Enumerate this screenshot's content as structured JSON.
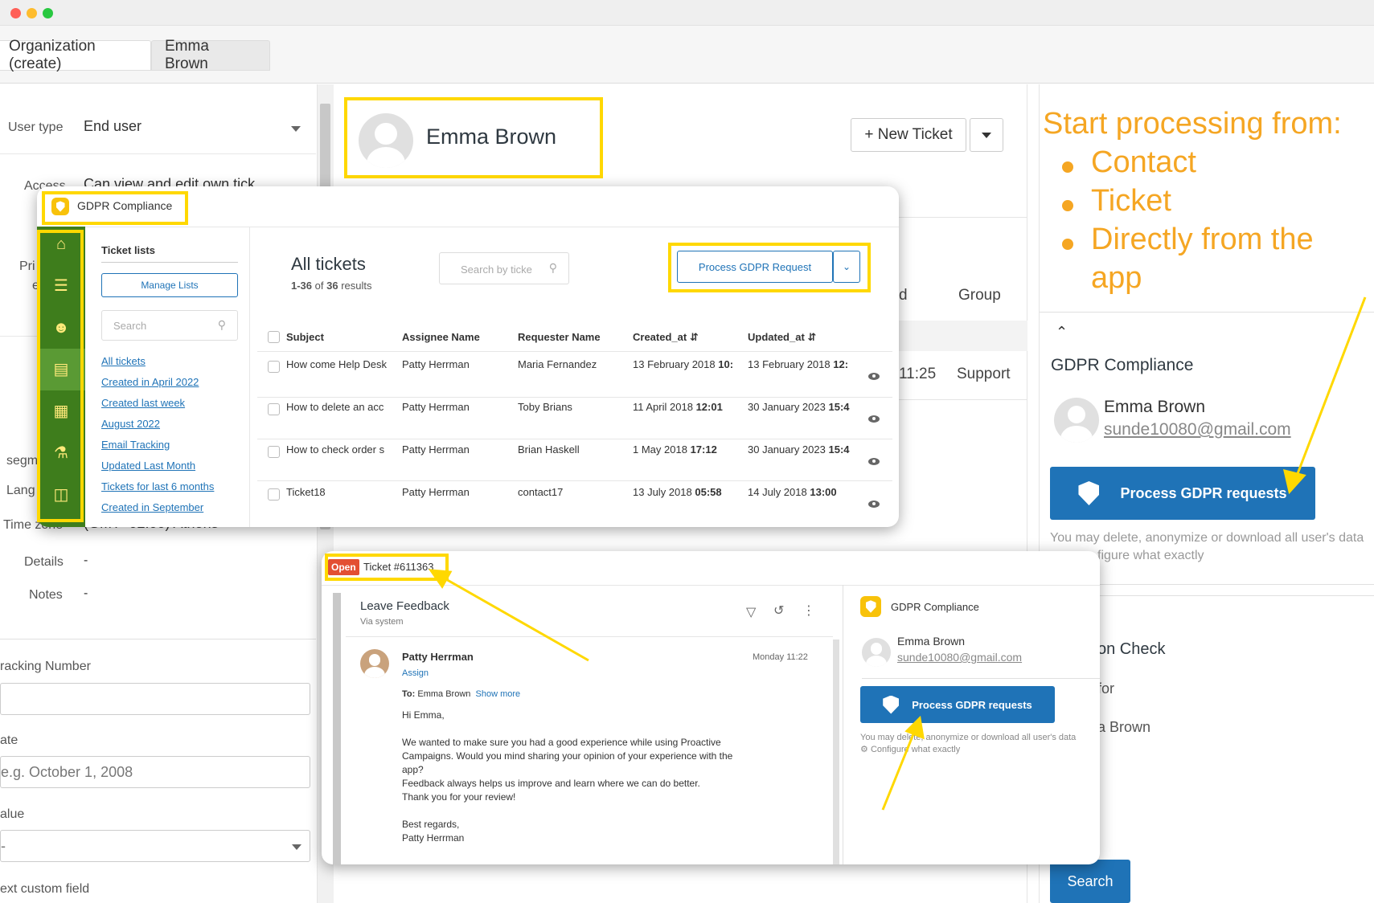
{
  "tabs": [
    "Organization (create)",
    "Emma Brown"
  ],
  "left_form": {
    "user_type_label": "User type",
    "user_type_value": "End user",
    "access_label": "Access",
    "access_value": "Can view and edit own tick",
    "primary_label": "Pri",
    "primary_label2": "e",
    "segment_label": "segm",
    "language_label": "Lang",
    "timezone_label": "Time zone",
    "timezone_value": "(GMT+02:00) Athens",
    "details_label": "Details",
    "details_value": "-",
    "notes_label": "Notes",
    "notes_value": "-",
    "tracking_label": "racking Number",
    "date_label": "ate",
    "date_placeholder": "e.g. October 1, 2008",
    "value_label": "alue",
    "value_value": "-",
    "custom_label": "ext custom field"
  },
  "mid": {
    "user_name": "Emma Brown",
    "new_ticket_label": "+ New Ticket",
    "col_d": "d",
    "col_group": "Group",
    "row_time": "11:25",
    "row_group": "Support"
  },
  "right": {
    "heading": "Start processing from:",
    "bullets": [
      "Contact",
      "Ticket",
      "Directly from the",
      "app"
    ],
    "panel_title": "GDPR Compliance",
    "user_name": "Emma Brown",
    "user_email": "sunde10080@gmail.com",
    "process_btn": "Process GDPR requests",
    "note1": "You may delete, anonymize or download all user's data",
    "note2": "figure what exactly",
    "section2": "on Check",
    "section2_for": "for",
    "section2_name": "a Brown",
    "search_btn": "Search"
  },
  "popup1": {
    "title": "GDPR Compliance",
    "ticket_lists": "Ticket lists",
    "manage_lists": "Manage Lists",
    "search_placeholder": "Search",
    "lists": [
      "All tickets",
      "Created in April 2022",
      "Created last week",
      "August 2022",
      "Email Tracking",
      "Updated Last Month",
      "Tickets for last 6 months",
      "Created in September"
    ],
    "all_tickets": "All tickets",
    "results_range": "1-36",
    "results_of": " of ",
    "results_total": "36",
    "results_word": " results",
    "search_tickets_placeholder": "Search by ticke",
    "process_btn": "Process GDPR Request",
    "columns": [
      "Subject",
      "Assignee Name",
      "Requester Name",
      "Created_at",
      "Updated_at"
    ],
    "rows": [
      {
        "subject": "How come Help Desk",
        "assignee": "Patty Herrman",
        "requester": "Maria Fernandez",
        "created_date": "13 February 2018",
        "created_time": "10:",
        "updated_date": "13 February 2018",
        "updated_time": "12:"
      },
      {
        "subject": "How to delete an acc",
        "assignee": "Patty Herrman",
        "requester": "Toby Brians",
        "created_date": "11 April 2018",
        "created_time": "12:01",
        "updated_date": "30 January 2023",
        "updated_time": "15:4"
      },
      {
        "subject": "How to check order s",
        "assignee": "Patty Herrman",
        "requester": "Brian Haskell",
        "created_date": "1 May 2018",
        "created_time": "17:12",
        "updated_date": "30 January 2023",
        "updated_time": "15:4"
      },
      {
        "subject": "Ticket18",
        "assignee": "Patty Herrman",
        "requester": "contact17",
        "created_date": "13 July 2018",
        "created_time": "05:58",
        "updated_date": "14 July 2018",
        "updated_time": "13:00"
      }
    ]
  },
  "popup2": {
    "status": "Open",
    "ticket_id": "Ticket #611363",
    "subject": "Leave Feedback",
    "via": "Via system",
    "author": "Patty Herrman",
    "assign": "Assign",
    "date": "Monday 11:22",
    "to_label": "To:",
    "to_value": "Emma Brown",
    "show_more": "Show more",
    "body": [
      "Hi Emma,",
      "",
      "We wanted to make sure you had a good experience while using Proactive",
      "Campaigns. Would you mind sharing your opinion of your experience with the",
      "app?",
      "Feedback always helps us improve and learn where we can do better.",
      "Thank you for your review!",
      "",
      "Best regards,",
      "Patty Herrman"
    ],
    "panel_title": "GDPR Compliance",
    "user_name": "Emma Brown",
    "user_email": "sunde10080@gmail.com",
    "process_btn": "Process GDPR requests",
    "note1": "You may delete, anonymize or download all user's data",
    "note2": "Configure what exactly"
  },
  "colors": {
    "highlight": "#ffd800",
    "accent_blue": "#1f73b7",
    "sidebar_green": "#3e7d1c",
    "annotation_orange": "#f5a623",
    "open_badge": "#e34f32"
  }
}
